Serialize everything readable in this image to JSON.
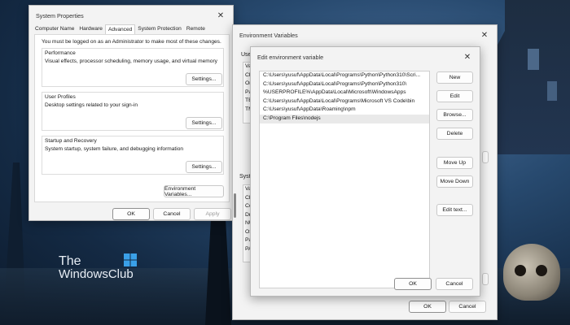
{
  "watermark": {
    "line1": "The",
    "line2": "WindowsClub"
  },
  "system_properties": {
    "title": "System Properties",
    "tabs": [
      "Computer Name",
      "Hardware",
      "Advanced",
      "System Protection",
      "Remote"
    ],
    "active_tab": "Advanced",
    "admin_note": "You must be logged on as an Administrator to make most of these changes.",
    "performance": {
      "title": "Performance",
      "description": "Visual effects, processor scheduling, memory usage, and virtual memory",
      "button": "Settings..."
    },
    "user_profiles": {
      "title": "User Profiles",
      "description": "Desktop settings related to your sign-in",
      "button": "Settings..."
    },
    "startup_recovery": {
      "title": "Startup and Recovery",
      "description": "System startup, system failure, and debugging information",
      "button": "Settings..."
    },
    "env_button": "Environment Variables...",
    "ok": "OK",
    "cancel": "Cancel",
    "apply": "Apply"
  },
  "environment_variables": {
    "title": "Environment Variables",
    "user_label": "Use",
    "user_rows": [
      "Va",
      "Ch",
      "On",
      "Pa",
      "TE",
      "TM"
    ],
    "system_label": "Syst",
    "system_rows": [
      "Va",
      "Ch",
      "Co",
      "Dr",
      "NU",
      "OS",
      "Pa",
      "PA"
    ],
    "ok": "OK",
    "cancel": "Cancel"
  },
  "edit_env": {
    "title": "Edit environment variable",
    "paths": [
      "C:\\Users\\yusuf\\AppData\\Local\\Programs\\Python\\Python310\\Scri...",
      "C:\\Users\\yusuf\\AppData\\Local\\Programs\\Python\\Python310\\",
      "%USERPROFILE%\\AppData\\Local\\Microsoft\\WindowsApps",
      "C:\\Users\\yusuf\\AppData\\Local\\Programs\\Microsoft VS Code\\bin",
      "C:\\Users\\yusuf\\AppData\\Roaming\\npm",
      "C:\\Program Files\\nodejs"
    ],
    "buttons": {
      "new": "New",
      "edit": "Edit",
      "browse": "Browse...",
      "delete": "Delete",
      "move_up": "Move Up",
      "move_down": "Move Down",
      "edit_text": "Edit text..."
    },
    "ok": "OK",
    "cancel": "Cancel"
  }
}
